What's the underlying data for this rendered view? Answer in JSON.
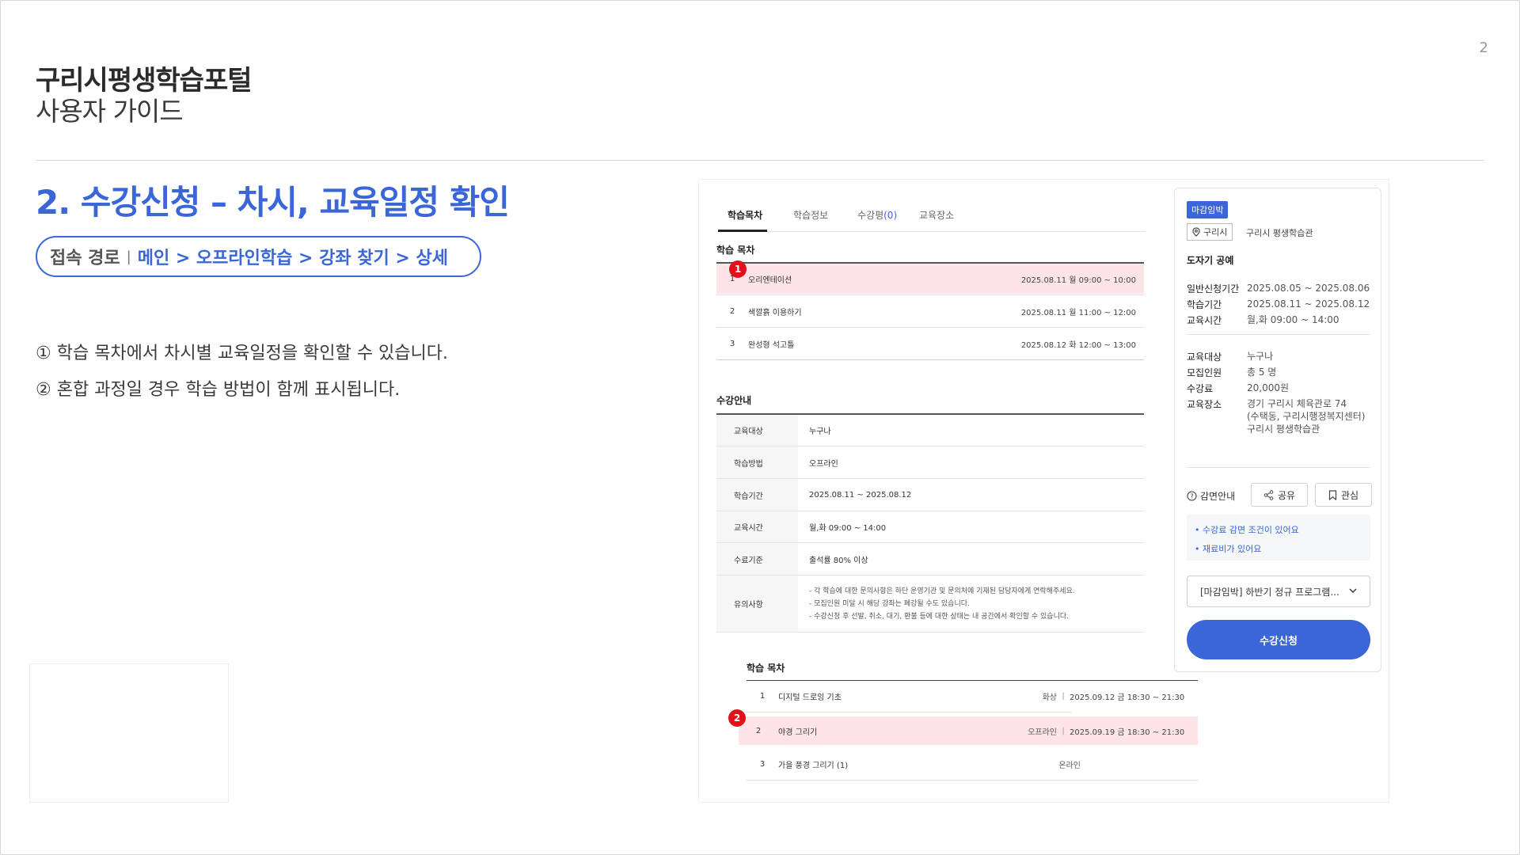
{
  "page_number": "2",
  "header": {
    "title": "구리시평생학습포털",
    "subtitle": "사용자 가이드"
  },
  "section": {
    "title": "2. 수강신청 – 차시, 교육일정 확인",
    "route_label": "접속 경로",
    "route_separator": "|",
    "route_path": "메인 > 오프라인학습 > 강좌 찾기 > 상세"
  },
  "descriptions": [
    "① 학습 목차에서 차시별 교육일정을 확인할 수 있습니다.",
    "② 혼합 과정일 경우 학습 방법이 함께 표시됩니다."
  ],
  "screenshot": {
    "tabs": [
      {
        "label": "학습목차",
        "active": true
      },
      {
        "label": "학습정보",
        "active": false
      },
      {
        "label": "수강평",
        "count": "(0)",
        "active": false
      },
      {
        "label": "교육장소",
        "active": false
      }
    ],
    "toc_heading": "학습 목차",
    "toc_rows": [
      {
        "num": "1",
        "title": "오리엔테이션",
        "date": "2025.08.11  월  09:00 ~ 10:00",
        "highlight": true
      },
      {
        "num": "2",
        "title": "색깔흙 이용하기",
        "date": "2025.08.11  월  11:00 ~ 12:00",
        "highlight": false
      },
      {
        "num": "3",
        "title": "완성형 석고틀",
        "date": "2025.08.12  화  12:00 ~ 13:00",
        "highlight": false
      }
    ],
    "markers": [
      "1",
      "2"
    ],
    "info_heading": "수강안내",
    "info_rows": [
      {
        "key": "교육대상",
        "value": "누구나"
      },
      {
        "key": "학습방법",
        "value": "오프라인"
      },
      {
        "key": "학습기간",
        "value": "2025.08.11 ~ 2025.08.12"
      },
      {
        "key": "교육시간",
        "value": "월,화 09:00 ~ 14:00"
      },
      {
        "key": "수료기준",
        "value": "출석률 80% 이상"
      }
    ],
    "notice_row": {
      "key": "유의사항",
      "lines": [
        "- 각 학습에 대한 문의사항은 하단 운영기관 및 문의처에 기재된 담당자에게 연락해주세요.",
        "- 모집인원 미달 시 해당 강좌는 폐강될 수도 있습니다.",
        "- 수강신청 후 선발, 취소, 대기, 환불 등에 대한 상태는 내 공간에서 확인할 수 있습니다."
      ]
    },
    "card": {
      "status_badge": "마감임박",
      "location_chip": "구리시",
      "location_name": "구리시 평생학습관",
      "course_name": "도자기 공예",
      "schedule": [
        {
          "key": "일반신청기간",
          "value": "2025.08.05 ~ 2025.08.06"
        },
        {
          "key": "학습기간",
          "value": "2025.08.11 ~ 2025.08.12"
        },
        {
          "key": "교육시간",
          "value": "월,화 09:00 ~ 14:00"
        }
      ],
      "details": [
        {
          "key": "교육대상",
          "value": "누구나"
        },
        {
          "key": "모집인원",
          "value": "총 5 명"
        },
        {
          "key": "수강료",
          "value": "20,000원"
        }
      ],
      "place_key": "교육장소",
      "place_lines": [
        "경기 구리시 체육관로 74",
        "(수택동, 구리시행정복지센터)",
        "구리시 평생학습관"
      ],
      "discount_label": "감면안내",
      "share_label": "공유",
      "bookmark_label": "관심",
      "notices": [
        "• 수강료 감면 조건이 있어요",
        "• 재료비가 있어요"
      ],
      "select_value": "[마감임박] 하반기 정규 프로그램...",
      "apply_label": "수강신청"
    },
    "toc2_heading": "학습 목차",
    "toc2_rows": [
      {
        "num": "1",
        "title": "디지털 드로잉 기초",
        "method": "화상",
        "date": "2025.09.12  금  18:30 ~ 21:30",
        "highlight": false
      },
      {
        "num": "2",
        "title": "야경 그리기",
        "method": "오프라인",
        "date": "2025.09.19  금  18:30 ~ 21:30",
        "highlight": true
      },
      {
        "num": "3",
        "title": "가을 풍경 그리기 (1)",
        "method": "온라인",
        "date": "",
        "highlight": false
      }
    ],
    "colors": {
      "accent": "#3a66d8",
      "highlight_row": "#fde4e6",
      "marker": "#e0111d"
    }
  }
}
